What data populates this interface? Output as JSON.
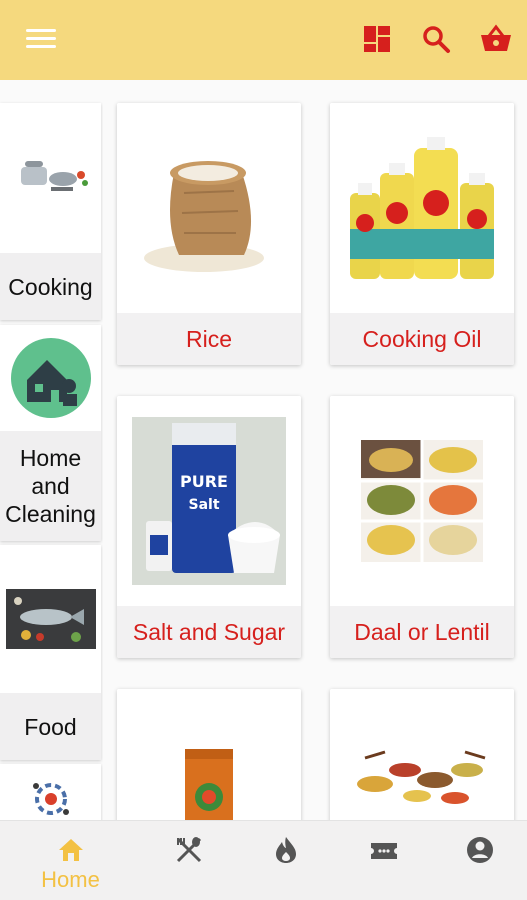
{
  "header": {
    "menu_icon": "hamburger-icon",
    "actions": [
      "grid-icon",
      "search-icon",
      "basket-icon"
    ],
    "colors": {
      "bar": "#f5d97e",
      "icons": "#d6201d"
    }
  },
  "categories": [
    {
      "label": "Cooking",
      "icon": "cookware-image"
    },
    {
      "label": "Home and Cleaning",
      "icon": "home-cleaning-image"
    },
    {
      "label": "Food",
      "icon": "fish-food-image"
    },
    {
      "label": "",
      "icon": "misc-category-image"
    }
  ],
  "products": [
    {
      "name": "Rice",
      "image": "rice-sack-image"
    },
    {
      "name": "Cooking Oil",
      "image": "oil-bottles-image"
    },
    {
      "name": "Salt and Sugar",
      "image": "salt-sugar-image"
    },
    {
      "name": "Daal or Lentil",
      "image": "lentils-image"
    },
    {
      "name": "",
      "image": "spice-pack-image"
    },
    {
      "name": "",
      "image": "spices-image"
    }
  ],
  "bottom_nav": [
    {
      "label": "Home",
      "icon": "home-icon",
      "active": true
    },
    {
      "label": "",
      "icon": "utensils-icon",
      "active": false
    },
    {
      "label": "",
      "icon": "flame-icon",
      "active": false
    },
    {
      "label": "",
      "icon": "ticket-icon",
      "active": false
    },
    {
      "label": "",
      "icon": "account-icon",
      "active": false
    }
  ]
}
